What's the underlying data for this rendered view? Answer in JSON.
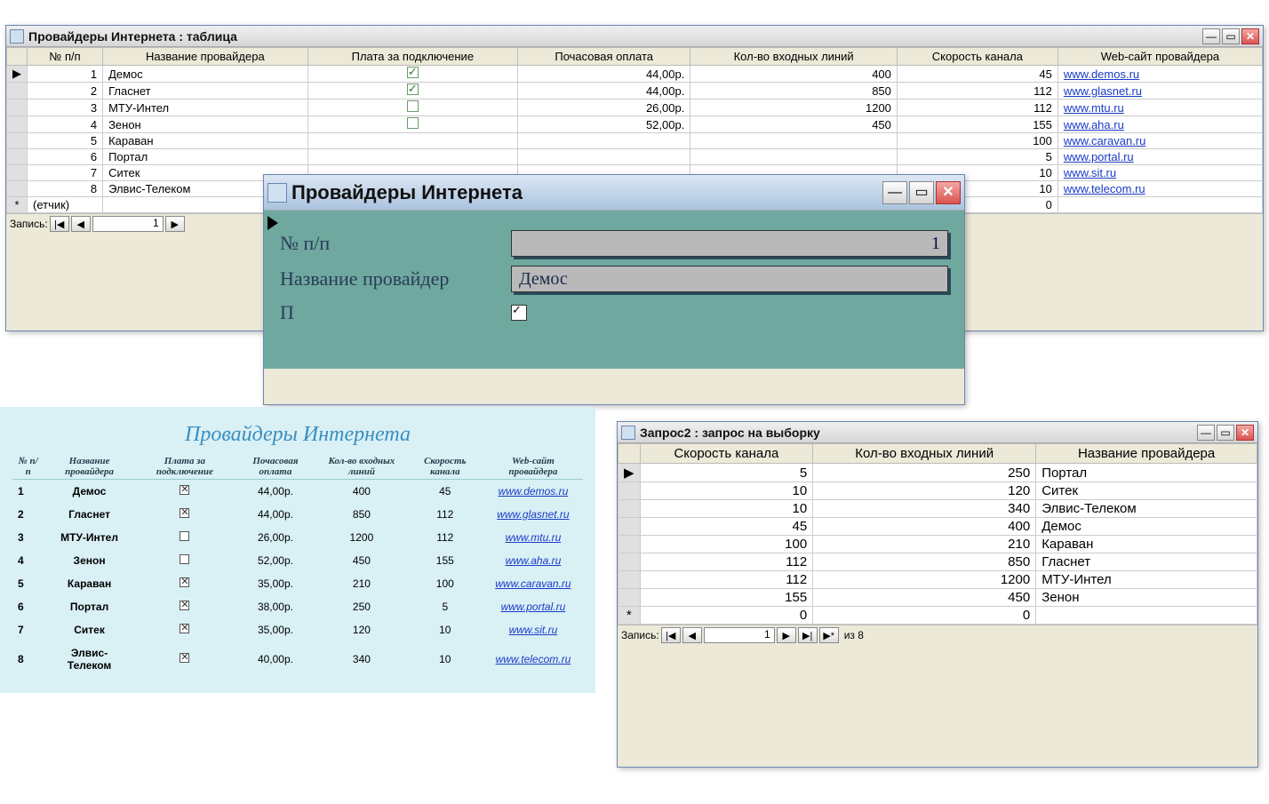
{
  "tableWin": {
    "title": "Провайдеры Интернета : таблица",
    "columns": [
      "№ п/п",
      "Название провайдера",
      "Плата за подключение",
      "Почасовая оплата",
      "Кол-во входных линий",
      "Скорость канала",
      "Web-сайт провайдера"
    ],
    "rows": [
      {
        "n": "1",
        "name": "Демос",
        "fee": true,
        "hourly": "44,00р.",
        "lines": "400",
        "speed": "45",
        "site": "www.demos.ru"
      },
      {
        "n": "2",
        "name": "Гласнет",
        "fee": true,
        "hourly": "44,00р.",
        "lines": "850",
        "speed": "112",
        "site": "www.glasnet.ru"
      },
      {
        "n": "3",
        "name": "МТУ-Интел",
        "fee": false,
        "hourly": "26,00р.",
        "lines": "1200",
        "speed": "112",
        "site": "www.mtu.ru"
      },
      {
        "n": "4",
        "name": "Зенон",
        "fee": false,
        "hourly": "52,00р.",
        "lines": "450",
        "speed": "155",
        "site": "www.aha.ru"
      },
      {
        "n": "5",
        "name": "Караван",
        "fee": null,
        "hourly": "",
        "lines": "",
        "speed": "100",
        "site": "www.caravan.ru"
      },
      {
        "n": "6",
        "name": "Портал",
        "fee": null,
        "hourly": "",
        "lines": "",
        "speed": "5",
        "site": "www.portal.ru"
      },
      {
        "n": "7",
        "name": "Ситек",
        "fee": null,
        "hourly": "",
        "lines": "",
        "speed": "10",
        "site": "www.sit.ru"
      },
      {
        "n": "8",
        "name": "Элвис-Телеком",
        "fee": null,
        "hourly": "",
        "lines": "",
        "speed": "10",
        "site": "www.telecom.ru"
      }
    ],
    "newrow_label": "(етчик)",
    "newrow_speed": "0",
    "nav_label": "Запись:",
    "nav_value": "1"
  },
  "formWin": {
    "title": "Провайдеры Интернета",
    "labels": {
      "num": "№ п/п",
      "name": "Название провайдер",
      "fee_partial": "П"
    },
    "values": {
      "num": "1",
      "name": "Демос",
      "fee": true
    }
  },
  "queryWin": {
    "title": "Запрос2 : запрос на выборку",
    "columns": [
      "Скорость канала",
      "Кол-во входных линий",
      "Название провайдера"
    ],
    "rows": [
      {
        "speed": "5",
        "lines": "250",
        "name": "Портал"
      },
      {
        "speed": "10",
        "lines": "120",
        "name": "Ситек"
      },
      {
        "speed": "10",
        "lines": "340",
        "name": "Элвис-Телеком"
      },
      {
        "speed": "45",
        "lines": "400",
        "name": "Демос"
      },
      {
        "speed": "100",
        "lines": "210",
        "name": "Караван"
      },
      {
        "speed": "112",
        "lines": "850",
        "name": "Гласнет"
      },
      {
        "speed": "112",
        "lines": "1200",
        "name": "МТУ-Интел"
      },
      {
        "speed": "155",
        "lines": "450",
        "name": "Зенон"
      }
    ],
    "newrow": {
      "speed": "0",
      "lines": "0",
      "name": ""
    },
    "nav_label": "Запись:",
    "nav_value": "1",
    "nav_total": "из 8"
  },
  "report": {
    "title": "Провайдеры Интернета",
    "columns": [
      "№ п/п",
      "Название провайдера",
      "Плата за подключение",
      "Почасовая оплата",
      "Кол-во входных линий",
      "Скорость канала",
      "Web-сайт провайдера"
    ],
    "rows": [
      {
        "n": "1",
        "name": "Демос",
        "fee": true,
        "hourly": "44,00р.",
        "lines": "400",
        "speed": "45",
        "site": "www.demos.ru"
      },
      {
        "n": "2",
        "name": "Гласнет",
        "fee": true,
        "hourly": "44,00р.",
        "lines": "850",
        "speed": "112",
        "site": "www.glasnet.ru"
      },
      {
        "n": "3",
        "name": "МТУ-Интел",
        "fee": false,
        "hourly": "26,00р.",
        "lines": "1200",
        "speed": "112",
        "site": "www.mtu.ru"
      },
      {
        "n": "4",
        "name": "Зенон",
        "fee": false,
        "hourly": "52,00р.",
        "lines": "450",
        "speed": "155",
        "site": "www.aha.ru"
      },
      {
        "n": "5",
        "name": "Караван",
        "fee": true,
        "hourly": "35,00р.",
        "lines": "210",
        "speed": "100",
        "site": "www.caravan.ru"
      },
      {
        "n": "6",
        "name": "Портал",
        "fee": true,
        "hourly": "38,00р.",
        "lines": "250",
        "speed": "5",
        "site": "www.portal.ru"
      },
      {
        "n": "7",
        "name": "Ситек",
        "fee": true,
        "hourly": "35,00р.",
        "lines": "120",
        "speed": "10",
        "site": "www.sit.ru"
      },
      {
        "n": "8",
        "name": "Элвис-Телеком",
        "fee": true,
        "hourly": "40,00р.",
        "lines": "340",
        "speed": "10",
        "site": "www.telecom.ru"
      }
    ]
  }
}
